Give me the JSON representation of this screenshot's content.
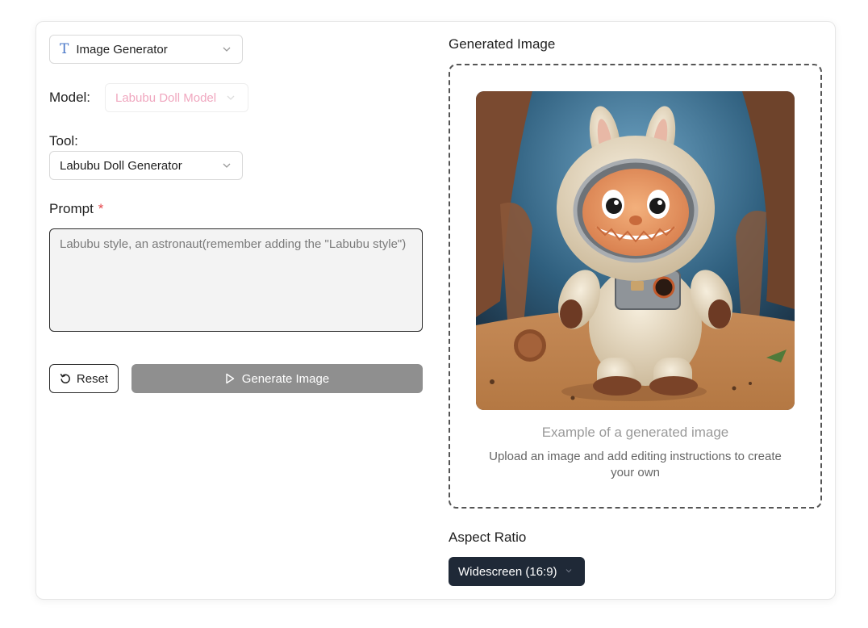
{
  "tool_type": {
    "label": "Image Generator",
    "icon": "text-t-icon"
  },
  "model": {
    "label": "Model:",
    "value": "Labubu Doll Model"
  },
  "tool": {
    "label": "Tool:",
    "value": "Labubu Doll Generator"
  },
  "prompt": {
    "label": "Prompt",
    "required_mark": "*",
    "placeholder": "Labubu style, an astronaut(remember adding the \"Labubu style\")"
  },
  "actions": {
    "reset_label": "Reset",
    "generate_label": "Generate Image"
  },
  "output": {
    "title": "Generated Image",
    "caption": "Example of a generated image",
    "subcaption": "Upload an image and add editing instructions to create your own"
  },
  "aspect_ratio": {
    "label": "Aspect Ratio",
    "value": "Widescreen (16:9)"
  },
  "colors": {
    "accent_disabled": "#8f8f8f",
    "dark_select": "#1f2937",
    "required": "#e5484d",
    "model_text": "#f0a7bf"
  }
}
